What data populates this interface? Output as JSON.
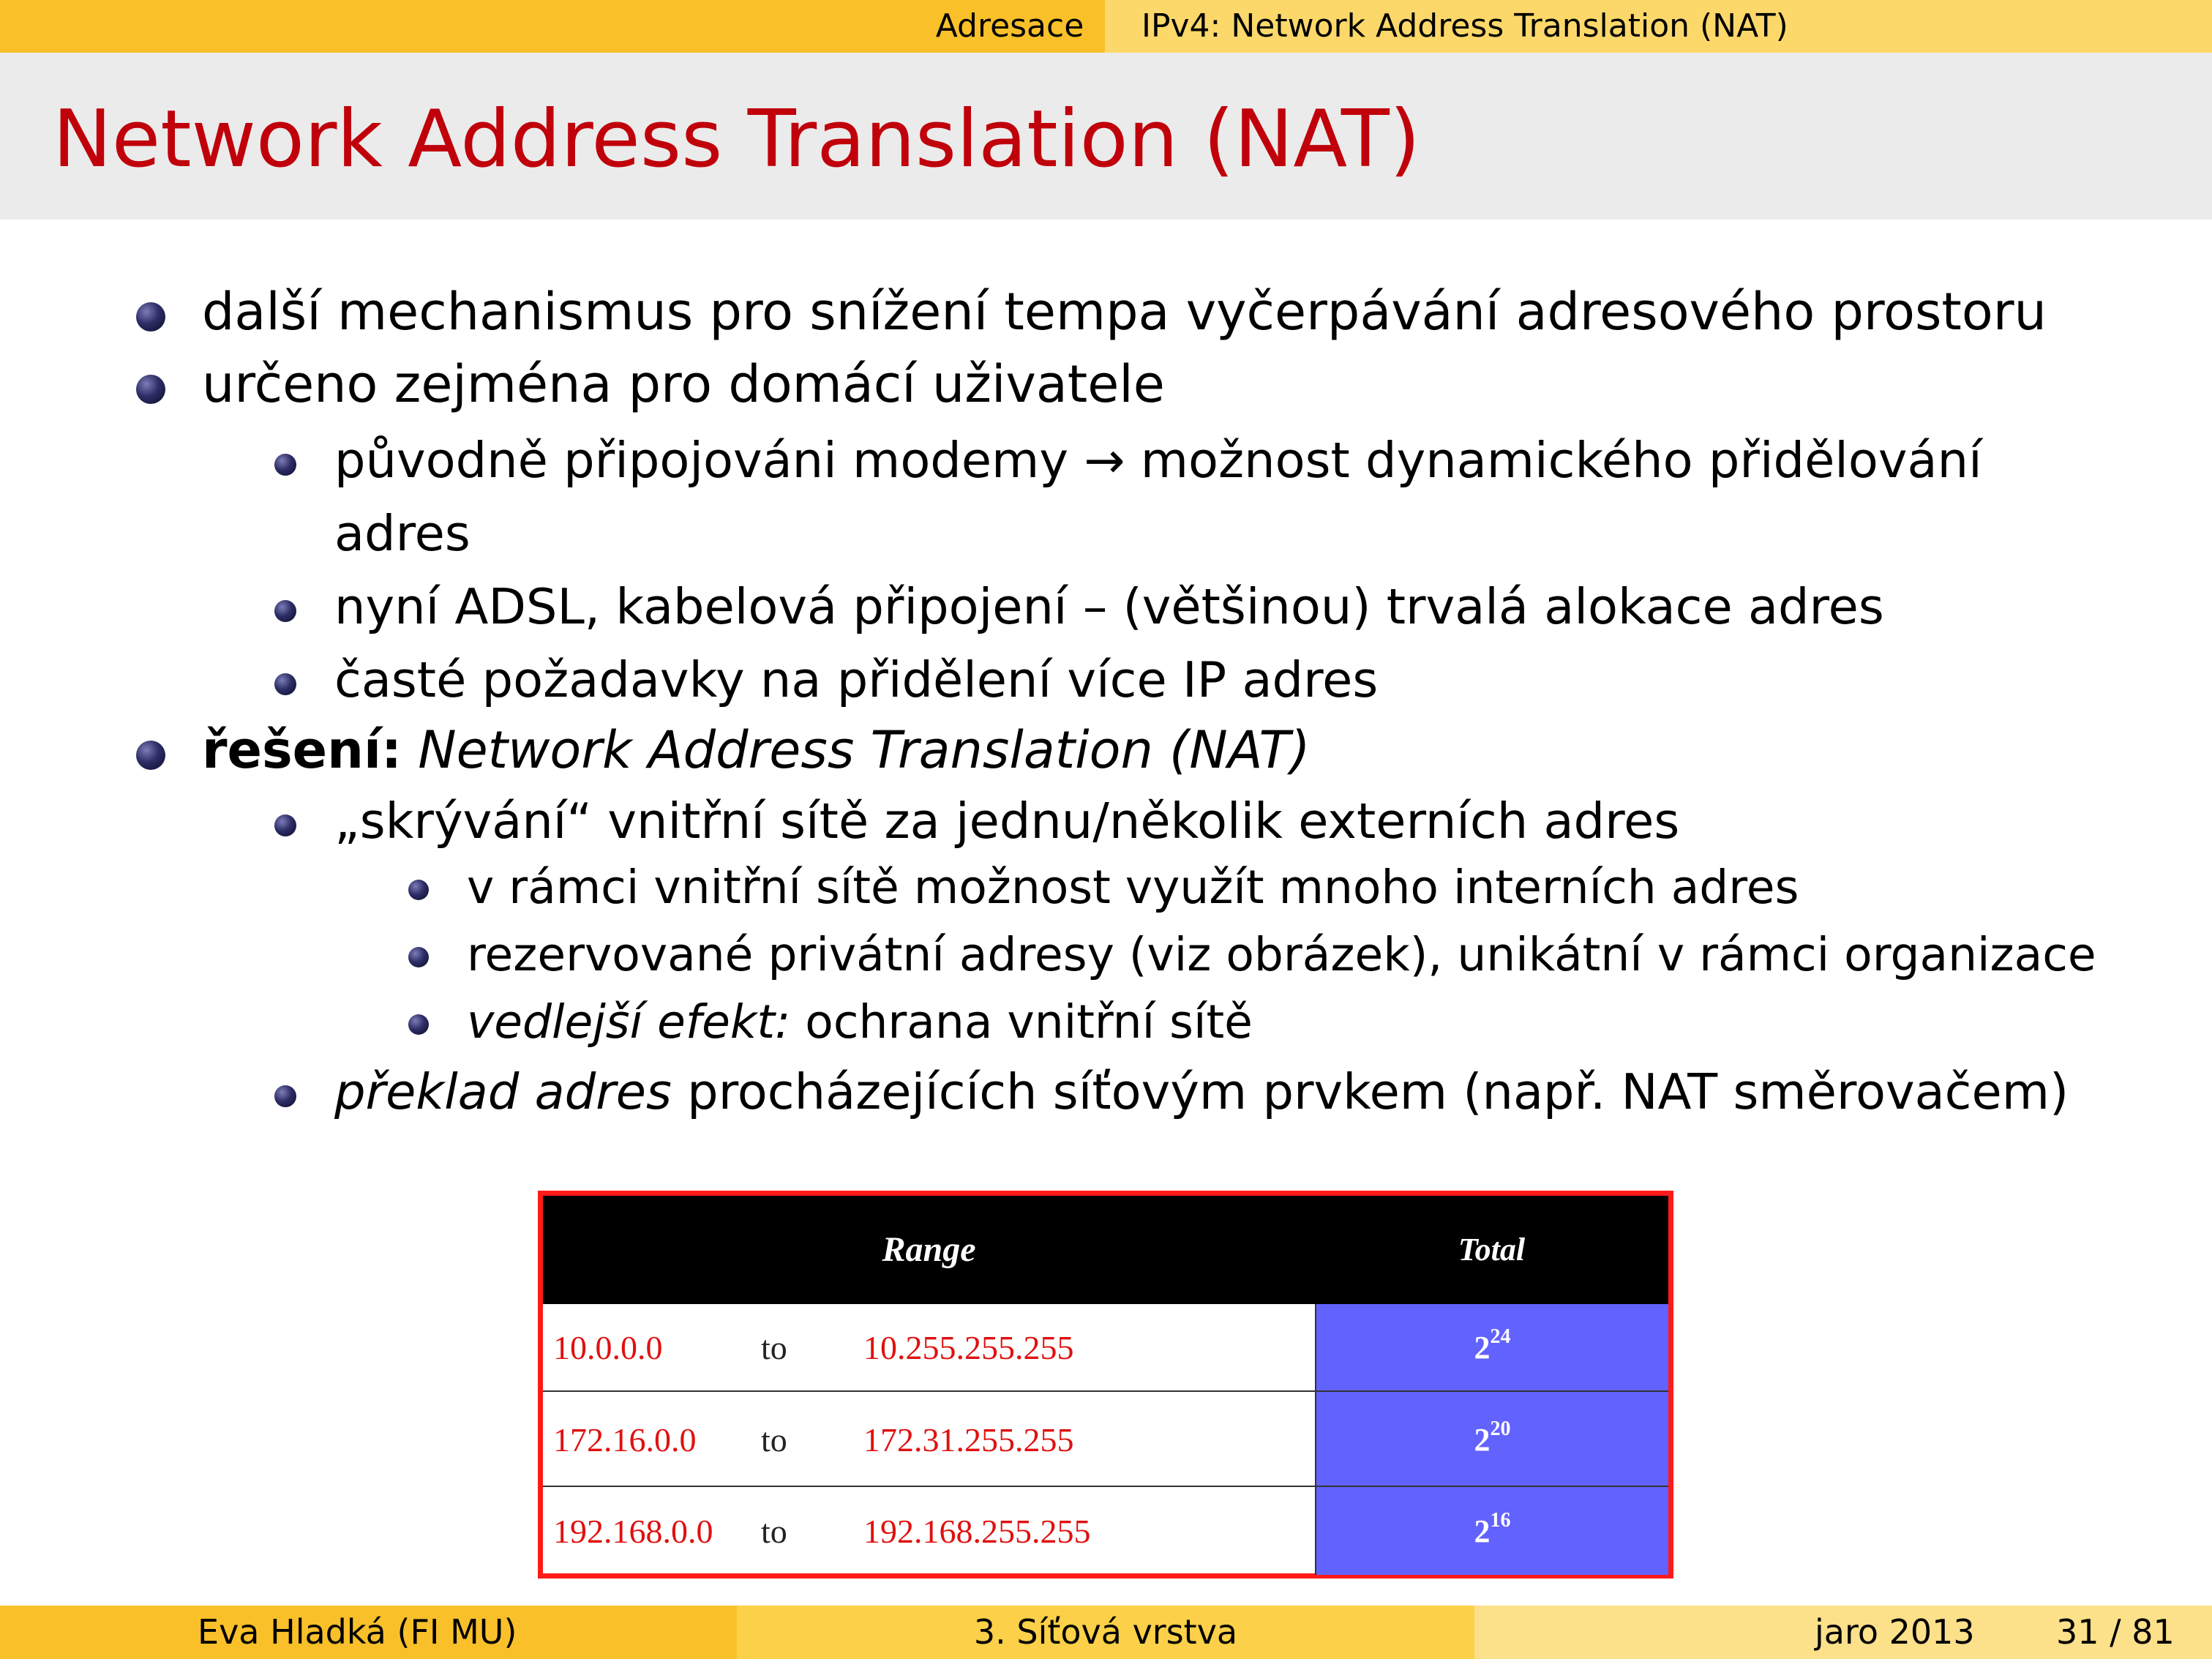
{
  "nav": {
    "section": "Adresace",
    "subsection": "IPv4: Network Address Translation (NAT)"
  },
  "frame_title": "Network Address Translation (NAT)",
  "bullets": {
    "b1": "další mechanismus pro snížení tempa vyčerpávání adresového prostoru",
    "b2": "určeno zejména pro domácí uživatele",
    "b2_1_line1": "původně připojováni modemy → možnost dynamického přidělování",
    "b2_1_line2": "adres",
    "b2_2": "nyní ADSL, kabelová připojení – (většinou) trvalá alokace adres",
    "b2_3": "časté požadavky na přidělení více IP adres",
    "b3_bold": "řešení:",
    "b3_italic": "Network Address Translation (NAT)",
    "b3_1": "„skrývání“ vnitřní sítě za jednu/několik externích adres",
    "b3_1_1": "v rámci vnitřní sítě možnost využít mnoho interních adres",
    "b3_1_2": "rezervované privátní adresy (viz obrázek), unikátní v rámci organizace",
    "b3_1_3_italic": "vedlejší efekt:",
    "b3_1_3_rest": "ochrana vnitřní sítě",
    "b3_2_italic": "překlad adres",
    "b3_2_rest": "procházejících síťovým prvkem (např. NAT směrovačem)"
  },
  "table": {
    "header_range": "Range",
    "header_total": "Total",
    "rows": [
      {
        "from": "10.0.0.0",
        "to": "to",
        "end": "10.255.255.255",
        "base": "2",
        "exp": "24"
      },
      {
        "from": "172.16.0.0",
        "to": "to",
        "end": "172.31.255.255",
        "base": "2",
        "exp": "20"
      },
      {
        "from": "192.168.0.0",
        "to": "to",
        "end": "192.168.255.255",
        "base": "2",
        "exp": "16"
      }
    ],
    "colors": {
      "border": "#ff1a1a",
      "header_bg": "#000000",
      "address_text": "#e01010",
      "total_bg": "#6262ff"
    }
  },
  "footer": {
    "author": "Eva Hladká  (FI MU)",
    "lecture": "3. Síťová vrstva",
    "date": "jaro 2013",
    "page": "31 / 81"
  },
  "theme": {
    "bar": "#f9c02a",
    "title_color": "#c0000a",
    "title_bg": "#ebebeb"
  }
}
